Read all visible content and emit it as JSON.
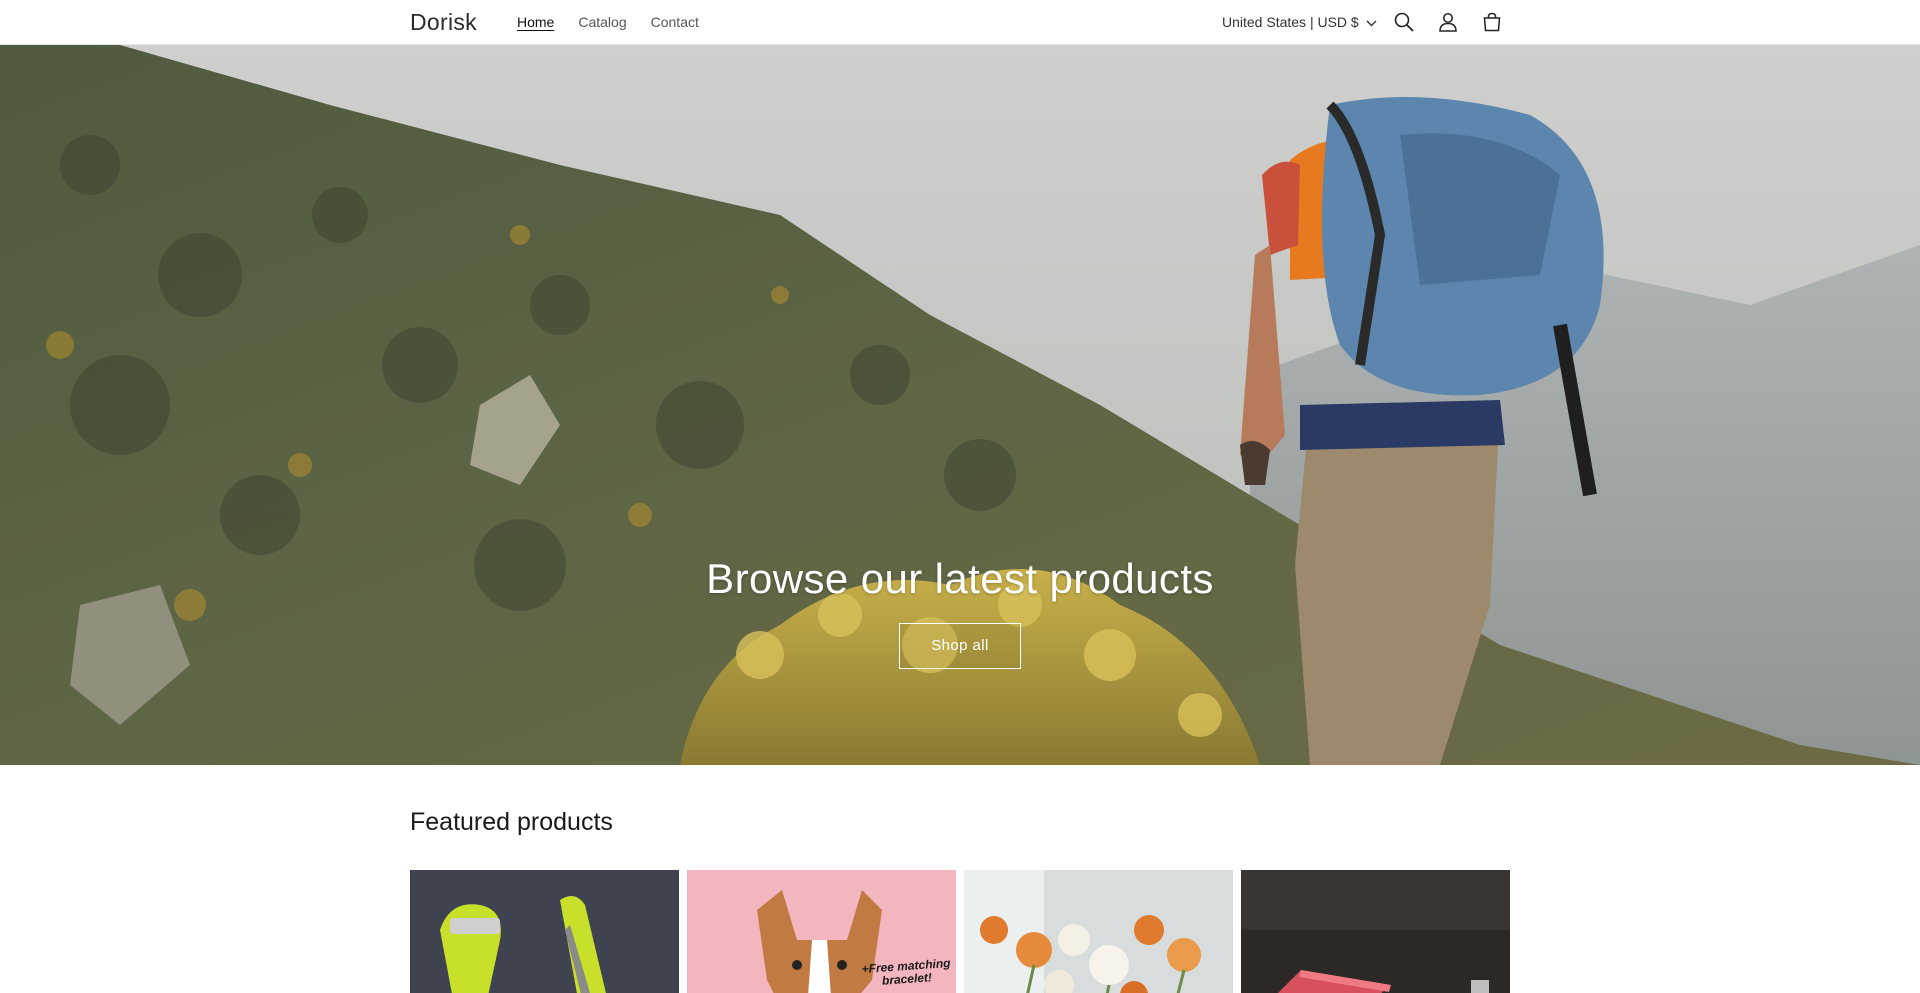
{
  "header": {
    "logo": "Dorisk",
    "nav": [
      {
        "label": "Home",
        "active": true
      },
      {
        "label": "Catalog",
        "active": false
      },
      {
        "label": "Contact",
        "active": false
      }
    ],
    "locale": "United States | USD $",
    "icons": [
      "chevron-down-icon",
      "search-icon",
      "account-icon",
      "cart-icon"
    ]
  },
  "hero": {
    "title": "Browse our latest products",
    "button_label": "Shop all"
  },
  "featured": {
    "title": "Featured products",
    "products": [
      {
        "image": "vegetable-peelers"
      },
      {
        "image": "dog-bandana",
        "caption_line1": "+Free matching",
        "caption_line2": "bracelet!"
      },
      {
        "image": "flower-bouquet"
      },
      {
        "image": "red-case"
      }
    ]
  },
  "colors": {
    "text": "#121212",
    "muted": "#555555",
    "border": "#e6e6e6",
    "hero_text": "#ffffff"
  }
}
